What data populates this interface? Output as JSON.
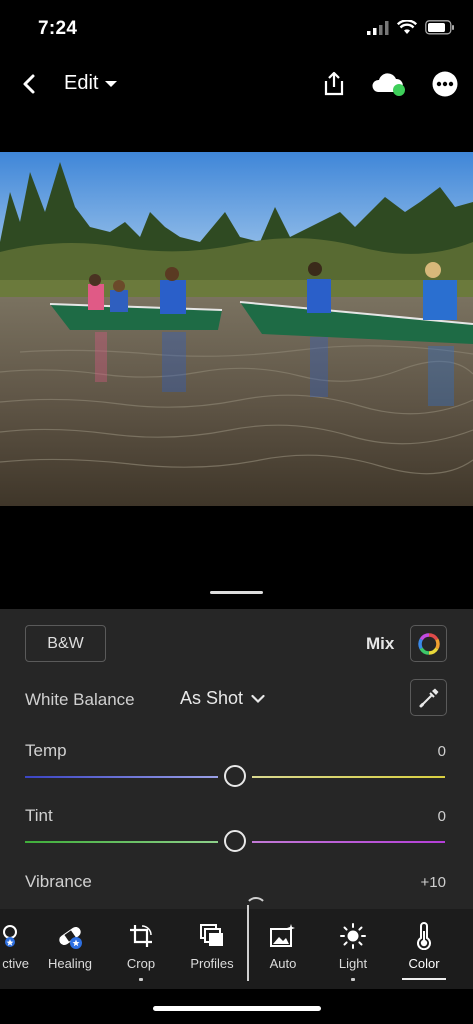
{
  "status_bar": {
    "time": "7:24"
  },
  "header": {
    "title": "Edit",
    "icons": [
      "back-chevron-icon",
      "caret-down-icon",
      "share-icon",
      "cloud-sync-icon",
      "more-icon"
    ],
    "sync_status_color": "#3ecf5a"
  },
  "photo": {
    "subject": "canoes on a lake"
  },
  "panel": {
    "bw_label": "B&W",
    "mix_label": "Mix",
    "white_balance": {
      "label": "White Balance",
      "value": "As Shot"
    },
    "sliders": [
      {
        "label": "Temp",
        "value": "0",
        "level": 0.5
      },
      {
        "label": "Tint",
        "value": "0",
        "level": 0.5
      },
      {
        "label": "Vibrance",
        "value": "+10",
        "level": 0.55
      }
    ]
  },
  "toolbar": {
    "items": [
      {
        "label": "ctive",
        "icon": "selective-icon"
      },
      {
        "label": "Healing",
        "icon": "healing-bandage-icon"
      },
      {
        "label": "Crop",
        "icon": "crop-icon"
      },
      {
        "label": "Profiles",
        "icon": "profiles-icon"
      },
      {
        "label": "Auto",
        "icon": "auto-sparkle-icon"
      },
      {
        "label": "Light",
        "icon": "sun-icon"
      },
      {
        "label": "Color",
        "icon": "thermometer-icon",
        "selected": true
      }
    ]
  },
  "colors": {
    "accent_badge": "#2d6fe0",
    "panel_bg": "#262626"
  }
}
